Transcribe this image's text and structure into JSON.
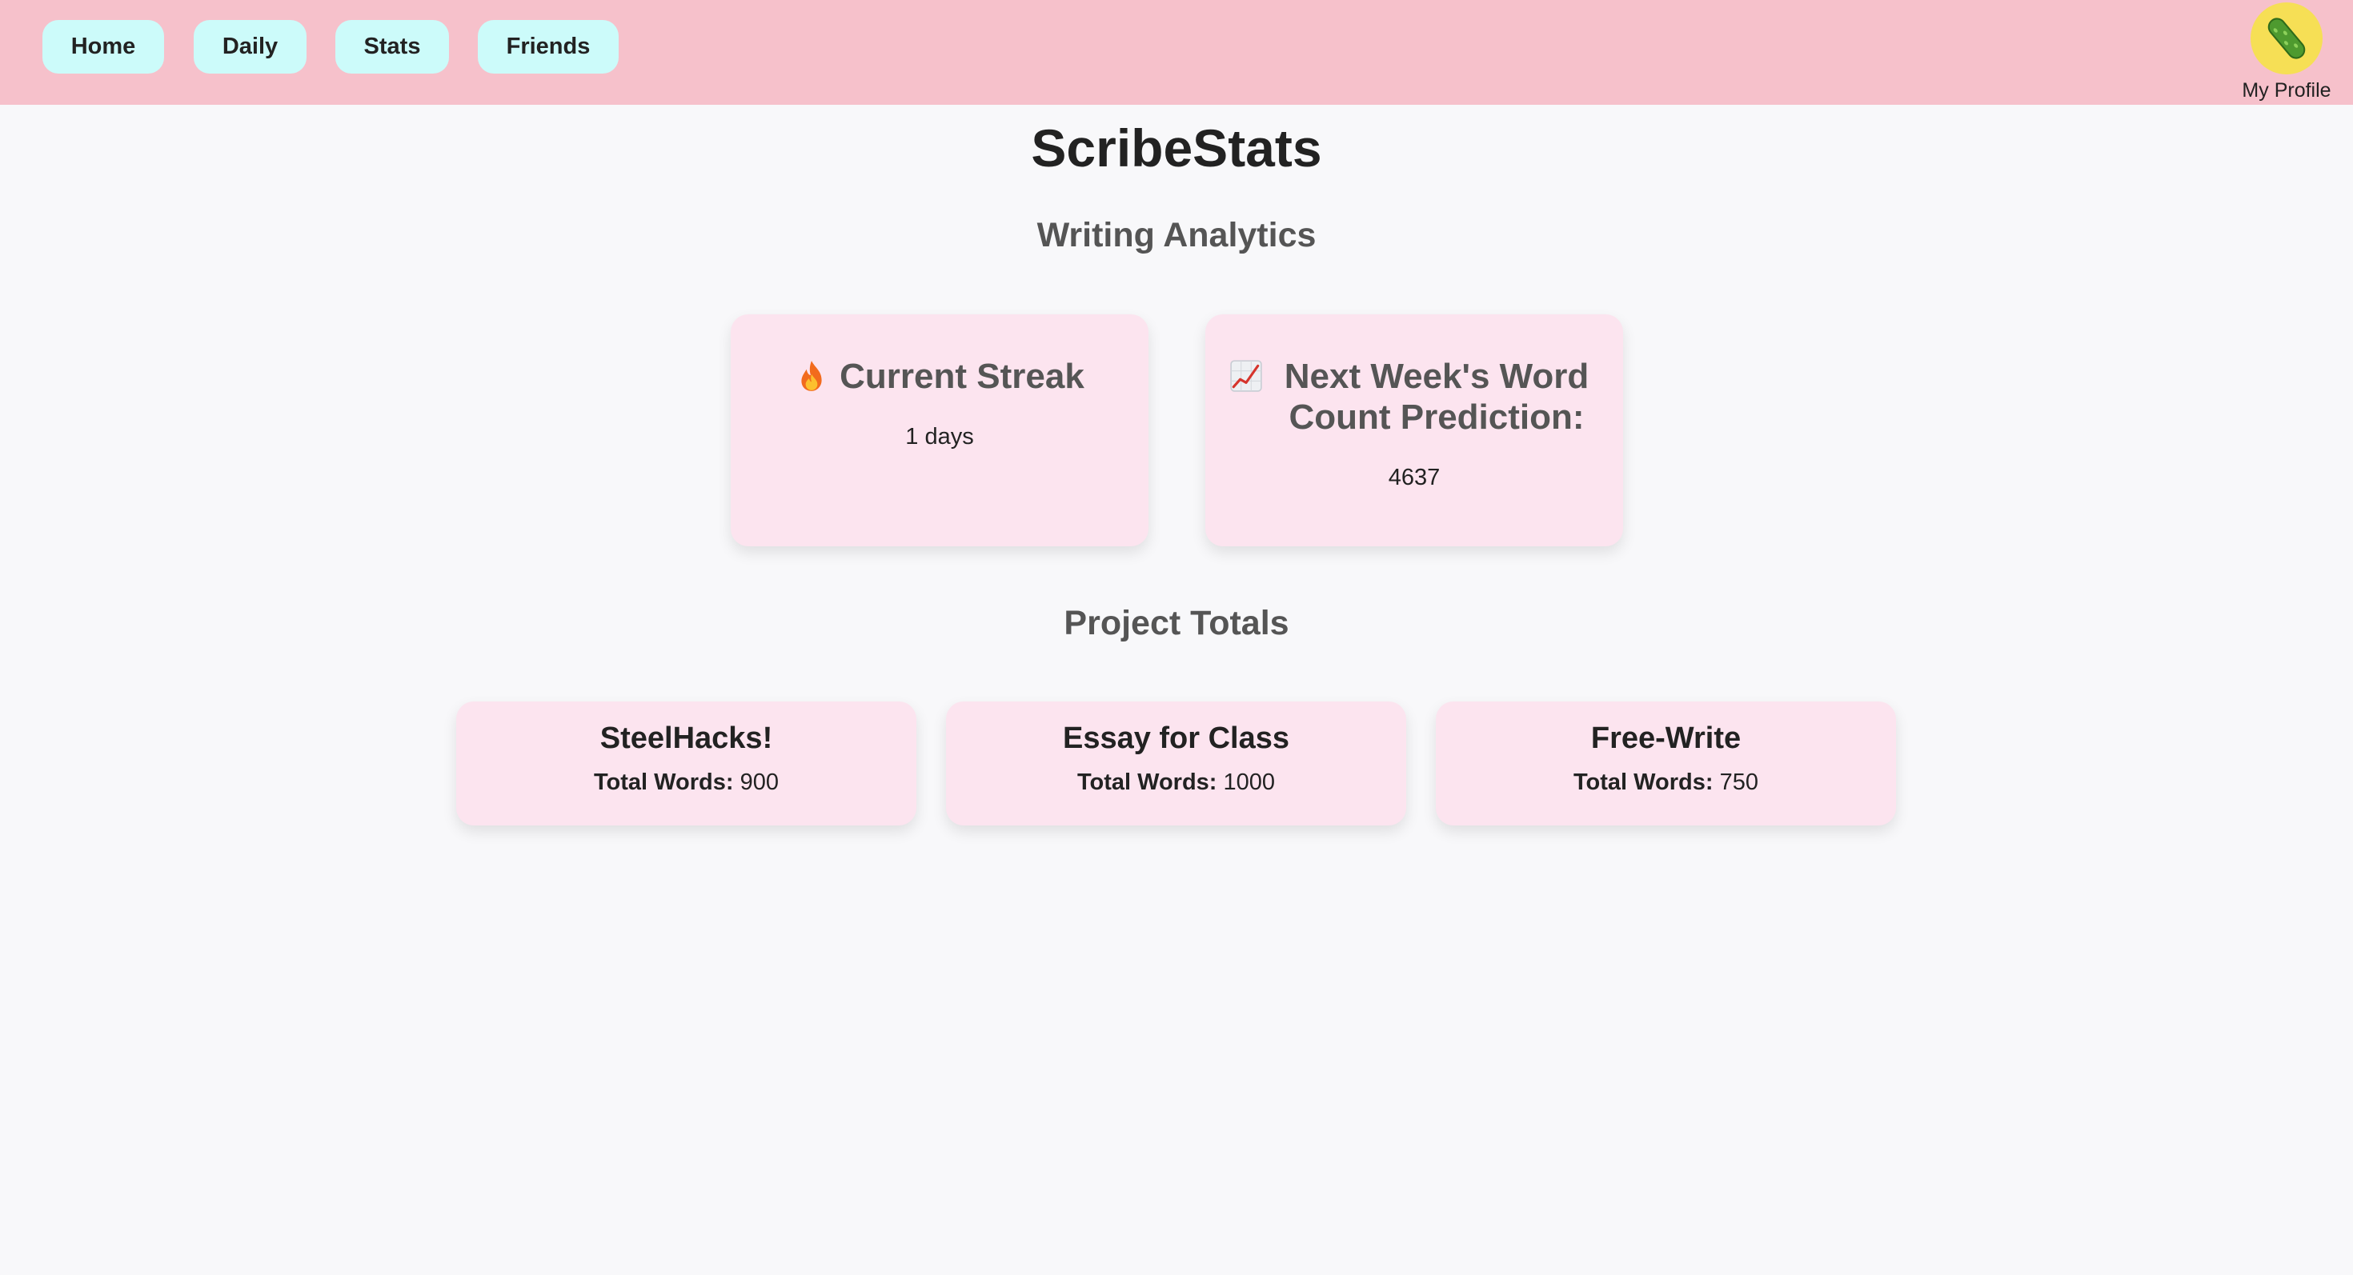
{
  "nav": {
    "home": "Home",
    "daily": "Daily",
    "stats": "Stats",
    "friends": "Friends",
    "profile_label": "My Profile",
    "profile_icon": "pickle-icon"
  },
  "page": {
    "title": "ScribeStats",
    "analytics_heading": "Writing Analytics",
    "projects_heading": "Project Totals"
  },
  "stats": {
    "streak": {
      "icon": "fire-icon",
      "title": "Current Streak",
      "value": "1 days"
    },
    "prediction": {
      "icon": "chart-increasing-icon",
      "title": "Next Week's Word Count Prediction:",
      "value": "4637"
    }
  },
  "projects": [
    {
      "name": "SteelHacks!",
      "label": "Total Words:",
      "total": "900"
    },
    {
      "name": "Essay for Class",
      "label": "Total Words:",
      "total": "1000"
    },
    {
      "name": "Free-Write",
      "label": "Total Words:",
      "total": "750"
    }
  ],
  "colors": {
    "navbar": "#f6c1cb",
    "nav_button": "#ccfbfa",
    "card": "#fce4ef",
    "background": "#f8f8fa",
    "avatar": "#f6df55"
  }
}
